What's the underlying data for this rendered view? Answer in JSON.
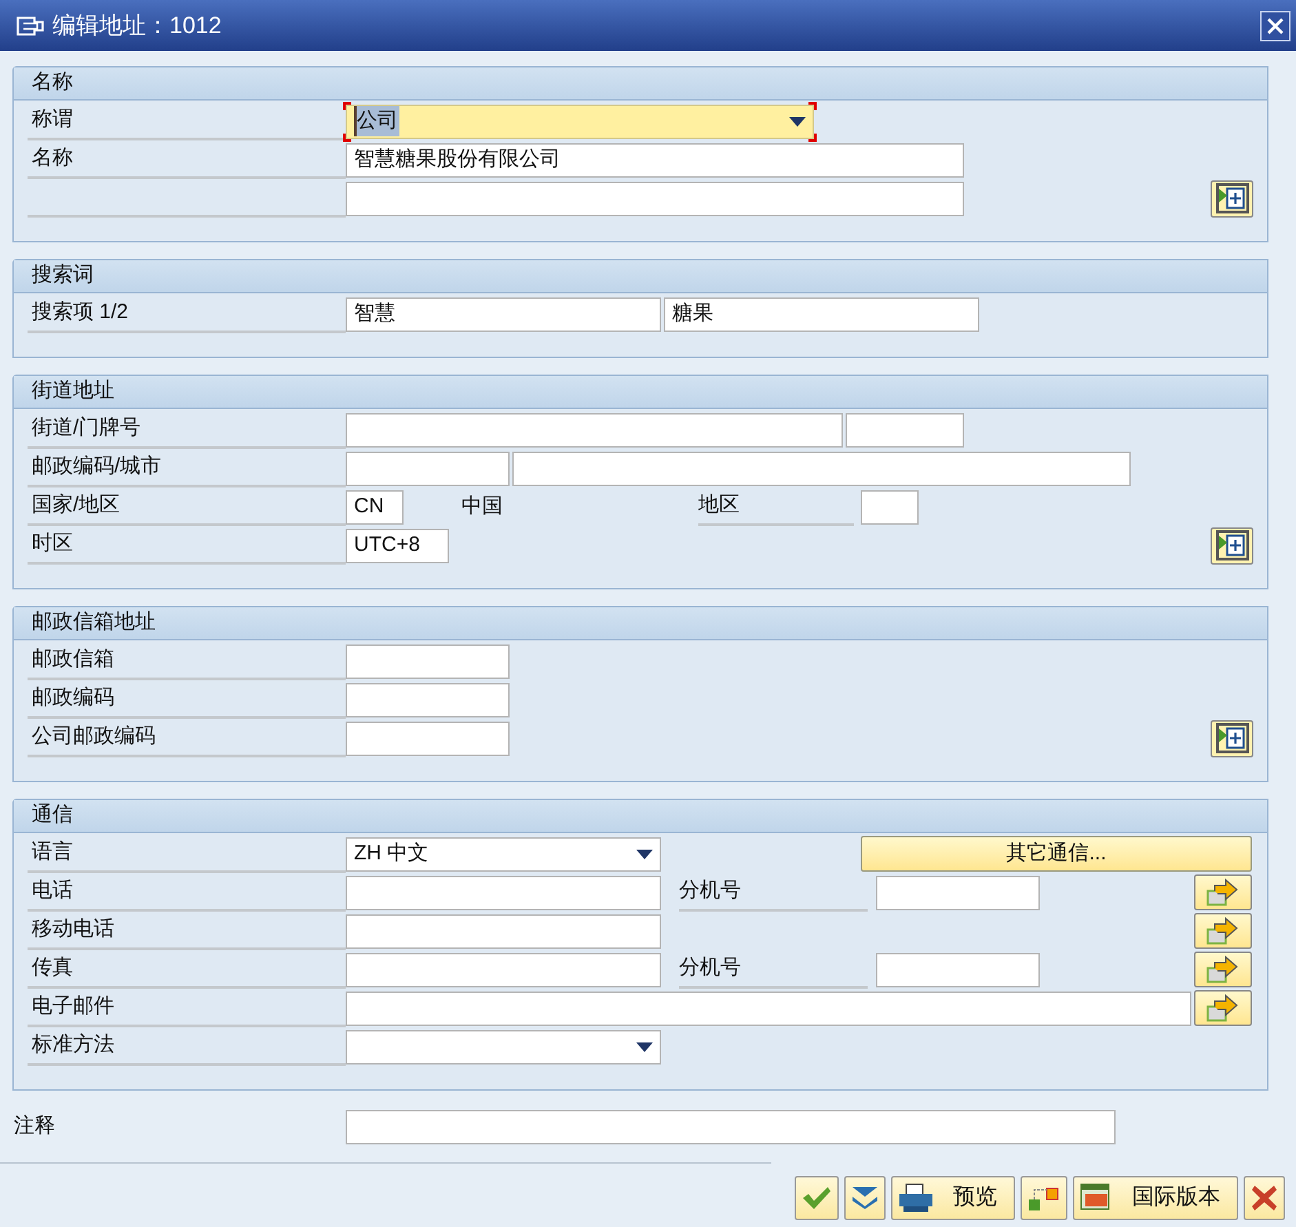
{
  "window": {
    "title": "编辑地址：1012"
  },
  "sections": [
    {
      "title": "名称",
      "rows": [
        {
          "label": "称谓",
          "items": [
            {
              "kind": "dropdown",
              "value": "公司",
              "focused": true
            }
          ]
        },
        {
          "label": "名称",
          "items": [
            {
              "kind": "field",
              "value": "智慧糖果股份有限公司"
            }
          ]
        },
        {
          "items": [
            {
              "kind": "field"
            },
            {
              "kind": "detail_button"
            }
          ]
        }
      ]
    },
    {
      "title": "搜索词",
      "rows": [
        {
          "label": "搜索项 1/2",
          "items": [
            {
              "kind": "field",
              "value": "智慧"
            },
            {
              "kind": "field",
              "value": "糖果"
            }
          ]
        }
      ]
    },
    {
      "title": "街道地址",
      "rows": [
        {
          "label": "街道/门牌号",
          "items": [
            {
              "kind": "field"
            },
            {
              "kind": "field"
            }
          ]
        },
        {
          "label": "邮政编码/城市",
          "items": [
            {
              "kind": "field"
            },
            {
              "kind": "field"
            }
          ]
        },
        {
          "label": "国家/地区",
          "items": [
            {
              "kind": "field",
              "value": "CN"
            },
            {
              "kind": "text",
              "value": "中国"
            },
            {
              "kind": "label",
              "value": "地区"
            },
            {
              "kind": "field"
            }
          ]
        },
        {
          "label": "时区",
          "items": [
            {
              "kind": "field",
              "value": "UTC+8"
            },
            {
              "kind": "detail_button"
            }
          ]
        }
      ]
    },
    {
      "title": "邮政信箱地址",
      "rows": [
        {
          "label": "邮政信箱",
          "items": [
            {
              "kind": "field"
            }
          ]
        },
        {
          "label": "邮政编码",
          "items": [
            {
              "kind": "field"
            }
          ]
        },
        {
          "label": "公司邮政编码",
          "items": [
            {
              "kind": "field"
            },
            {
              "kind": "detail_button"
            }
          ]
        }
      ]
    },
    {
      "title": "通信",
      "rows": [
        {
          "label": "语言",
          "items": [
            {
              "kind": "dropdown",
              "value": "ZH 中文",
              "focused": false
            },
            {
              "kind": "button",
              "value": "其它通信..."
            }
          ]
        },
        {
          "label": "电话",
          "items": [
            {
              "kind": "field"
            },
            {
              "kind": "label",
              "value": "分机号"
            },
            {
              "kind": "field"
            },
            {
              "kind": "arrow_button"
            }
          ]
        },
        {
          "label": "移动电话",
          "items": [
            {
              "kind": "field"
            },
            {
              "kind": "arrow_button"
            }
          ]
        },
        {
          "label": "传真",
          "items": [
            {
              "kind": "field"
            },
            {
              "kind": "label",
              "value": "分机号"
            },
            {
              "kind": "field"
            },
            {
              "kind": "arrow_button"
            }
          ]
        },
        {
          "label": "电子邮件",
          "items": [
            {
              "kind": "field"
            },
            {
              "kind": "arrow_button"
            }
          ]
        },
        {
          "label": "标准方法",
          "items": [
            {
              "kind": "dropdown",
              "focused": false
            }
          ]
        }
      ]
    }
  ],
  "comment": {
    "label": "注释"
  },
  "toolbar": [
    {
      "kind": "confirm"
    },
    {
      "kind": "expand"
    },
    {
      "kind": "print",
      "label": "预览"
    },
    {
      "kind": "squares"
    },
    {
      "kind": "window",
      "label": "国际版本"
    },
    {
      "kind": "cancel"
    }
  ]
}
